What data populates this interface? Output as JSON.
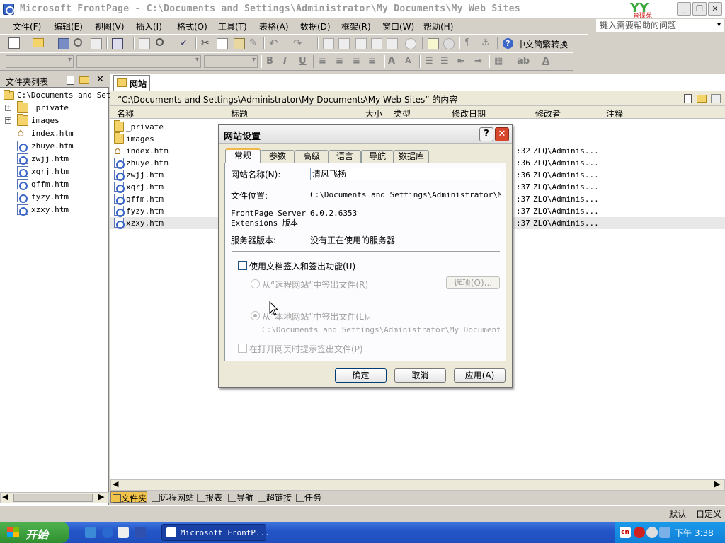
{
  "window": {
    "title": "Microsoft FrontPage - C:\\Documents and Settings\\Administrator\\My Documents\\My Web Sites",
    "logo_text": "育碟苑"
  },
  "menu": [
    "文件(F)",
    "编辑(E)",
    "视图(V)",
    "插入(I)",
    "格式(O)",
    "工具(T)",
    "表格(A)",
    "数据(D)",
    "框架(R)",
    "窗口(W)",
    "帮助(H)"
  ],
  "help_placeholder": "键入需要帮助的问题",
  "toolbar": {
    "convert_label": "中文简繁转换"
  },
  "folder_list": {
    "title": "文件夹列表",
    "root": "C:\\Documents and Sett",
    "items": [
      {
        "name": "_private",
        "type": "folder"
      },
      {
        "name": "images",
        "type": "folder"
      },
      {
        "name": "index.htm",
        "type": "home"
      },
      {
        "name": "zhuye.htm",
        "type": "htm"
      },
      {
        "name": "zwjj.htm",
        "type": "htm"
      },
      {
        "name": "xqrj.htm",
        "type": "htm"
      },
      {
        "name": "qffm.htm",
        "type": "htm"
      },
      {
        "name": "fyzy.htm",
        "type": "htm"
      },
      {
        "name": "xzxy.htm",
        "type": "htm"
      }
    ]
  },
  "main": {
    "tab": "网站",
    "path": "“C:\\Documents and Settings\\Administrator\\My Documents\\My Web Sites” 的内容",
    "columns": [
      "名称",
      "标题",
      "大小",
      "类型",
      "修改日期",
      "修改者",
      "注释"
    ],
    "rows": [
      {
        "name": "_private",
        "type": "folder",
        "time": "",
        "modifier": ""
      },
      {
        "name": "images",
        "type": "folder",
        "time": "",
        "modifier": ""
      },
      {
        "name": "index.htm",
        "type": "home",
        "time": ":32",
        "modifier": "ZLQ\\Adminis..."
      },
      {
        "name": "zhuye.htm",
        "type": "htm",
        "time": ":36",
        "modifier": "ZLQ\\Adminis..."
      },
      {
        "name": "zwjj.htm",
        "type": "htm",
        "time": ":36",
        "modifier": "ZLQ\\Adminis..."
      },
      {
        "name": "xqrj.htm",
        "type": "htm",
        "time": ":37",
        "modifier": "ZLQ\\Adminis..."
      },
      {
        "name": "qffm.htm",
        "type": "htm",
        "time": ":37",
        "modifier": "ZLQ\\Adminis..."
      },
      {
        "name": "fyzy.htm",
        "type": "htm",
        "time": ":37",
        "modifier": "ZLQ\\Adminis..."
      },
      {
        "name": "xzxy.htm",
        "type": "htm",
        "time": ":37",
        "modifier": "ZLQ\\Adminis...",
        "selected": true
      }
    ]
  },
  "view_tabs": [
    "文件夹",
    "远程网站",
    "报表",
    "导航",
    "超链接",
    "任务"
  ],
  "status": {
    "default": "默认",
    "custom": "自定义"
  },
  "dialog": {
    "title": "网站设置",
    "tabs": [
      "常规",
      "参数",
      "高级",
      "语言",
      "导航",
      "数据库"
    ],
    "site_name_label": "网站名称(N):",
    "site_name_value": "清风飞扬",
    "file_location_label": "文件位置:",
    "file_location_value": "C:\\Documents and Settings\\Administrator\\My Dc",
    "server_ext_label_1": "FrontPage Server",
    "server_ext_label_2": "Extensions 版本",
    "server_ext_value": "6.0.2.6353",
    "server_version_label": "服务器版本:",
    "server_version_value": "没有正在使用的服务器",
    "checkin_label": "使用文档签入和签出功能(U)",
    "remote_label": "从“远程网站”中签出文件(R)",
    "options_button": "选项(O)...",
    "local_label": "从“本地网站”中签出文件(L)。",
    "local_path": "C:\\Documents and Settings\\Administrator\\My Documents\\My",
    "prompt_label": "在打开网页时提示签出文件(P)",
    "ok_button": "确定",
    "cancel_button": "取消",
    "apply_button": "应用(A)"
  },
  "taskbar": {
    "start_label": "开始",
    "task_label": "Microsoft FrontP...",
    "clock": "下午 3:38"
  }
}
